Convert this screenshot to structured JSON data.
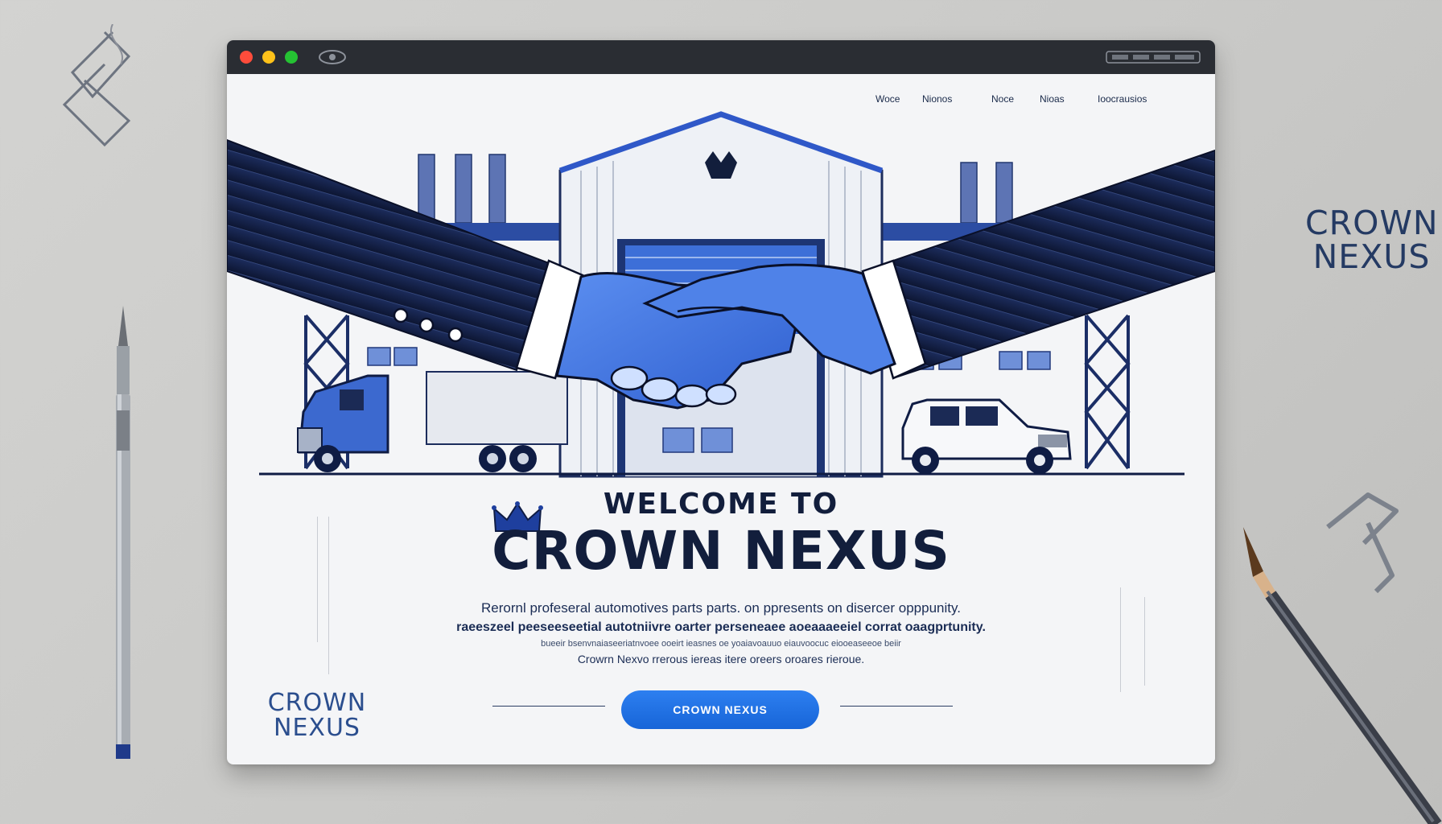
{
  "colors": {
    "desk": "#cacac8",
    "navy": "#121e3c",
    "brand_blue": "#1e6ee6",
    "window_bg": "#f4f5f7"
  },
  "desk": {
    "side_logo": [
      "CROWN",
      "NEXUS"
    ],
    "props": [
      "pen-icon",
      "pencil-icon",
      "paperclip-icon"
    ]
  },
  "window": {
    "titlebar_icons": [
      "close-dot",
      "minimize-dot",
      "maximize-dot",
      "eye-icon"
    ],
    "nav": [
      "Woce",
      "Nionos",
      "Noce",
      "Nioas",
      "Ioocrausios"
    ],
    "hero": {
      "illustration": "handshake-over-warehouse",
      "welcome": "WELCOME TO",
      "brand": "CROWN NEXUS",
      "crown_icon": "crown-icon"
    },
    "copy": [
      "Rerornl profeseral automotives parts parts. on ppresents on disercer opppunity.",
      "raeeszeel peeseeseetial autotniivre oarter perseneaee aoeaaaeeiel corrat oaagprtunity.",
      "bueeir bsenvnaiaseeriatnvoee ooeirt ieasnes oe yoaiavoauuo eiauvoocuc eiooeaseeoe beiir",
      "Crowrn Nexvo rrerous iereas itere oreers oroares rieroue."
    ],
    "cta_label": "CROWN NEXUS",
    "footer_logo": [
      "CROWN",
      "NEXUS"
    ]
  }
}
